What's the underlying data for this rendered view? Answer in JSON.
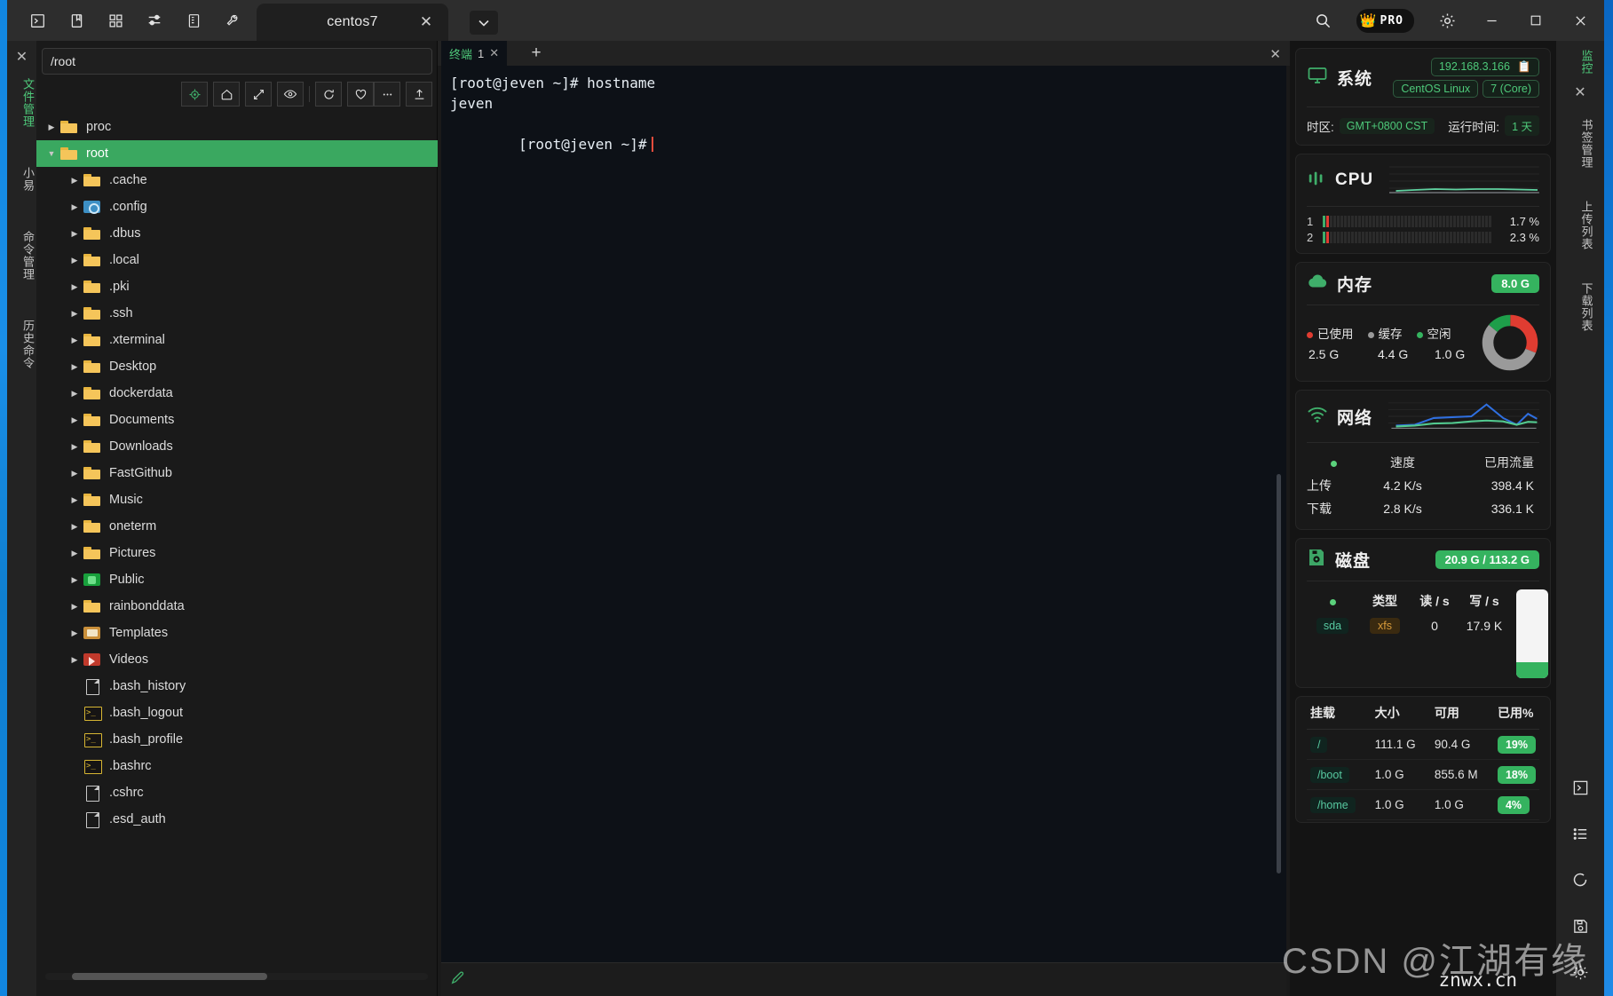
{
  "titlebar": {
    "icons": [
      {
        "name": "terminal-icon",
        "glyph": "›"
      },
      {
        "name": "book-icon",
        "glyph": "book"
      },
      {
        "name": "grid-icon",
        "glyph": "grid"
      },
      {
        "name": "sliders-icon",
        "glyph": "sliders"
      },
      {
        "name": "server-icon",
        "glyph": "server"
      },
      {
        "name": "wrench-icon",
        "glyph": "wrench"
      }
    ],
    "tab_label": "centos7",
    "tab_close": "✕",
    "tab_dropdown": "⌄",
    "search_icon": "search-icon",
    "pro_label": "PRO",
    "crown": "👑",
    "gear_icon": "gear-icon",
    "minimize": "—",
    "maximize": "☐",
    "close": "✕"
  },
  "left_rail": {
    "close": "✕",
    "items": [
      {
        "label": "文件管理",
        "active": true
      },
      {
        "label": "小易",
        "active": false
      },
      {
        "label": "命令管理",
        "active": false
      },
      {
        "label": "历史命令",
        "active": false
      }
    ]
  },
  "right_rail": {
    "items": [
      {
        "label": "监控",
        "active": true
      },
      {
        "label": "书签管理",
        "active": false
      },
      {
        "label": "上传列表",
        "active": false
      },
      {
        "label": "下载列表",
        "active": false
      }
    ],
    "close": "✕",
    "bottom_icons": [
      {
        "name": "terminal-icon"
      },
      {
        "name": "list-icon"
      },
      {
        "name": "refresh-icon"
      },
      {
        "name": "save-icon"
      },
      {
        "name": "gear-icon"
      }
    ]
  },
  "file_manager": {
    "path_value": "/root",
    "path_placeholder": "/root",
    "toolbar": [
      {
        "name": "locate-button",
        "title": "locate"
      },
      {
        "name": "home-button",
        "title": "home"
      },
      {
        "name": "collapse-button",
        "title": "collapse"
      },
      {
        "name": "show-hidden-button",
        "title": "show hidden"
      },
      {
        "name": "refresh-button",
        "title": "refresh"
      },
      {
        "name": "favorite-button",
        "title": "favorite"
      },
      {
        "name": "more-button",
        "title": "more"
      },
      {
        "name": "upload-button",
        "title": "upload"
      }
    ],
    "tree": [
      {
        "label": "proc",
        "icon": "folder",
        "indent": 0,
        "arrow": true,
        "selected": false
      },
      {
        "label": "root",
        "icon": "folder",
        "indent": 0,
        "arrow": true,
        "expanded": true,
        "selected": true
      },
      {
        "label": ".cache",
        "icon": "folder",
        "indent": 1,
        "arrow": true,
        "selected": false
      },
      {
        "label": ".config",
        "icon": "folder-blue",
        "indent": 1,
        "arrow": true,
        "selected": false
      },
      {
        "label": ".dbus",
        "icon": "folder",
        "indent": 1,
        "arrow": true,
        "selected": false
      },
      {
        "label": ".local",
        "icon": "folder",
        "indent": 1,
        "arrow": true,
        "selected": false
      },
      {
        "label": ".pki",
        "icon": "folder",
        "indent": 1,
        "arrow": true,
        "selected": false
      },
      {
        "label": ".ssh",
        "icon": "folder",
        "indent": 1,
        "arrow": true,
        "selected": false
      },
      {
        "label": ".xterminal",
        "icon": "folder",
        "indent": 1,
        "arrow": true,
        "selected": false
      },
      {
        "label": "Desktop",
        "icon": "folder",
        "indent": 1,
        "arrow": true,
        "selected": false
      },
      {
        "label": "dockerdata",
        "icon": "folder",
        "indent": 1,
        "arrow": true,
        "selected": false
      },
      {
        "label": "Documents",
        "icon": "folder",
        "indent": 1,
        "arrow": true,
        "selected": false
      },
      {
        "label": "Downloads",
        "icon": "folder",
        "indent": 1,
        "arrow": true,
        "selected": false
      },
      {
        "label": "FastGithub",
        "icon": "folder",
        "indent": 1,
        "arrow": true,
        "selected": false
      },
      {
        "label": "Music",
        "icon": "folder",
        "indent": 1,
        "arrow": true,
        "selected": false
      },
      {
        "label": "oneterm",
        "icon": "folder",
        "indent": 1,
        "arrow": true,
        "selected": false
      },
      {
        "label": "Pictures",
        "icon": "folder",
        "indent": 1,
        "arrow": true,
        "selected": false
      },
      {
        "label": "Public",
        "icon": "folder-green",
        "indent": 1,
        "arrow": true,
        "selected": false
      },
      {
        "label": "rainbonddata",
        "icon": "folder",
        "indent": 1,
        "arrow": true,
        "selected": false
      },
      {
        "label": "Templates",
        "icon": "folder-tpl",
        "indent": 1,
        "arrow": true,
        "selected": false
      },
      {
        "label": "Videos",
        "icon": "folder-red",
        "indent": 1,
        "arrow": true,
        "selected": false
      },
      {
        "label": ".bash_history",
        "icon": "file",
        "indent": 1,
        "arrow": false,
        "selected": false
      },
      {
        "label": ".bash_logout",
        "icon": "sh",
        "indent": 1,
        "arrow": false,
        "selected": false
      },
      {
        "label": ".bash_profile",
        "icon": "sh",
        "indent": 1,
        "arrow": false,
        "selected": false
      },
      {
        "label": ".bashrc",
        "icon": "sh",
        "indent": 1,
        "arrow": false,
        "selected": false
      },
      {
        "label": ".cshrc",
        "icon": "file",
        "indent": 1,
        "arrow": false,
        "selected": false
      },
      {
        "label": ".esd_auth",
        "icon": "file",
        "indent": 1,
        "arrow": false,
        "selected": false
      }
    ]
  },
  "terminal": {
    "tab_label": "终端",
    "tab_number": "1",
    "tab_close": "✕",
    "new_tab": "+",
    "close_all": "✕",
    "lines": [
      "[root@jeven ~]# hostname",
      "jeven",
      "[root@jeven ~]#"
    ],
    "status_icon": "pen-icon"
  },
  "monitor": {
    "system": {
      "title": "系统",
      "icon": "monitor-icon",
      "ip": "192.168.3.166",
      "copy_icon": "copy-icon",
      "os_name": "CentOS Linux",
      "os_version": "7 (Core)",
      "timezone_label": "时区:",
      "timezone_value": "GMT+0800  CST",
      "uptime_label": "运行时间:",
      "uptime_value": "1 天"
    },
    "cpu": {
      "title": "CPU",
      "icon": "cpu-icon",
      "cores": [
        {
          "index": "1",
          "percent": "1.7 %",
          "value": 1.7
        },
        {
          "index": "2",
          "percent": "2.3 %",
          "value": 2.3
        }
      ]
    },
    "memory": {
      "title": "内存",
      "icon": "cloud-icon",
      "total_badge": "8.0 G",
      "legend": [
        {
          "label": "已使用",
          "value": "2.5 G",
          "color": "#e03c31"
        },
        {
          "label": "缓存",
          "value": "4.4 G",
          "color": "#9a9a9a"
        },
        {
          "label": "空闲",
          "value": "1.0 G",
          "color": "#35b35f"
        }
      ]
    },
    "network": {
      "title": "网络",
      "icon": "wifi-icon",
      "headers": [
        "",
        "速度",
        "已用流量"
      ],
      "rows": [
        {
          "name": "上传",
          "speed": "4.2 K/s",
          "total": "398.4 K"
        },
        {
          "name": "下载",
          "speed": "2.8 K/s",
          "total": "336.1 K"
        }
      ]
    },
    "disk": {
      "title": "磁盘",
      "icon": "disk-icon",
      "usage_badge": "20.9 G / 113.2 G",
      "headers": [
        "",
        "类型",
        "读 / s",
        "写 / s"
      ],
      "rows": [
        {
          "device": "sda",
          "fstype": "xfs",
          "read": "0",
          "write": "17.9 K"
        }
      ],
      "gauge_percent": 18
    },
    "mounts": {
      "headers": [
        "挂载",
        "大小",
        "可用",
        "已用%"
      ],
      "rows": [
        {
          "mount": "/",
          "size": "111.1 G",
          "avail": "90.4 G",
          "used": "19%"
        },
        {
          "mount": "/boot",
          "size": "1.0 G",
          "avail": "855.6 M",
          "used": "18%"
        },
        {
          "mount": "/home",
          "size": "1.0 G",
          "avail": "1.0 G",
          "used": "4%"
        }
      ]
    }
  },
  "watermark": {
    "main": "CSDN @江湖有缘",
    "sub": "znwx.cn"
  },
  "colors": {
    "accent_green": "#35b35f",
    "select_green": "#3aa860",
    "chip_green": "#4ec97a",
    "red": "#e03c31",
    "blue": "#1186e0"
  }
}
